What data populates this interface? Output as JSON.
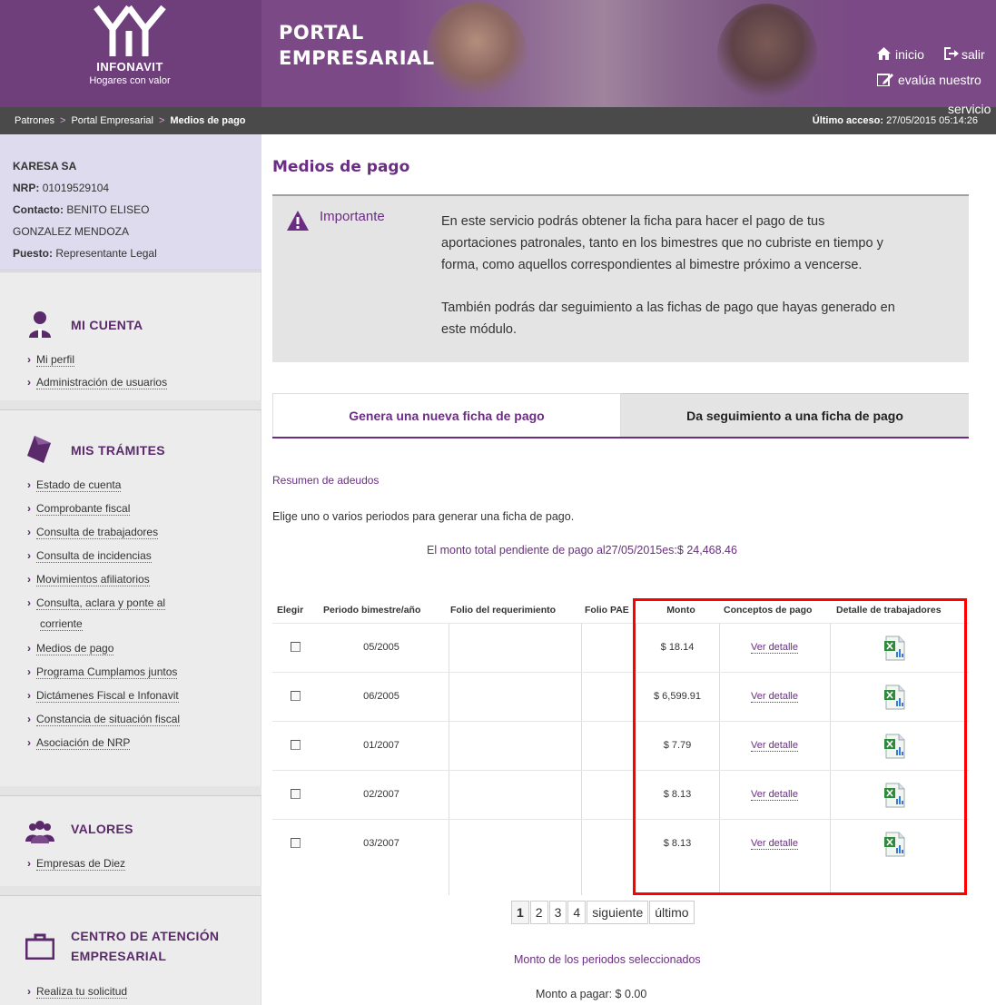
{
  "header": {
    "logo_text": "INFONAVIT",
    "logo_sub": "Hogares con valor",
    "portal_line1": "PORTAL",
    "portal_line2": "EMPRESARIAL",
    "inicio": "inicio",
    "salir": "salir",
    "evalua": "evalúa nuestro",
    "servicio": "servicio"
  },
  "breadcrumb": {
    "items": [
      "Patrones",
      "Portal Empresarial",
      "Medios de pago"
    ],
    "separator": ">",
    "access_label": "Último acceso:",
    "access_value": "27/05/2015 05:14:26"
  },
  "profile": {
    "company": "KARESA SA",
    "nrp_label": "NRP:",
    "nrp_value": "01019529104",
    "contact_label": "Contacto:",
    "contact_value_1": "BENITO ELISEO",
    "contact_value_2": "GONZALEZ MENDOZA",
    "puesto_label": "Puesto:",
    "puesto_value": "Representante Legal"
  },
  "sidebar": {
    "mi_cuenta": {
      "title": "MI CUENTA",
      "items": [
        "Mi perfil",
        "Administración de usuarios"
      ]
    },
    "mis_tramites": {
      "title": "MIS TRÁMITES",
      "items": [
        "Estado de cuenta",
        "Comprobante fiscal",
        "Consulta de trabajadores",
        "Consulta de incidencias",
        "Movimientos afiliatorios",
        "Consulta, aclara y ponte al",
        "corriente",
        "Medios de pago",
        "Programa Cumplamos juntos",
        "Dictámenes Fiscal e Infonavit",
        "Constancia de situación fiscal",
        "Asociación de NRP"
      ]
    },
    "valores": {
      "title": "VALORES",
      "items": [
        "Empresas de Diez"
      ]
    },
    "centro": {
      "title_1": "CENTRO DE ATENCIÓN",
      "title_2": "EMPRESARIAL",
      "items": [
        "Realiza tu solicitud"
      ]
    }
  },
  "main": {
    "title": "Medios de pago",
    "notice": {
      "label": "Importante",
      "p1_l1": "En este servicio podrás obtener la ficha para hacer el pago de tus",
      "p1_l2": "aportaciones patronales, tanto en los bimestres que no cubriste en tiempo y",
      "p1_l3": "forma, como aquellos correspondientes al bimestre próximo a vencerse.",
      "p2_l1": "También podrás dar seguimiento a las fichas de pago que hayas generado en",
      "p2_l2": "este módulo."
    },
    "tabs": [
      "Genera una nueva ficha de pago",
      "Da seguimiento a una ficha de pago"
    ],
    "resumen": "Resumen de adeudos",
    "elige": "Elige uno o varios periodos para generar una ficha de pago.",
    "monto_total": "El monto total pendiente de pago al27/05/2015es:$ 24,468.46",
    "table": {
      "headers": [
        "Elegir",
        "Periodo bimestre/año",
        "Folio del requerimiento",
        "Folio PAE",
        "Monto",
        "Conceptos de pago",
        "Detalle de trabajadores"
      ],
      "rows": [
        {
          "periodo": "05/2005",
          "monto": "$ 18.14",
          "concepto": "Ver detalle"
        },
        {
          "periodo": "06/2005",
          "monto": "$ 6,599.91",
          "concepto": "Ver detalle"
        },
        {
          "periodo": "01/2007",
          "monto": "$ 7.79",
          "concepto": "Ver detalle"
        },
        {
          "periodo": "02/2007",
          "monto": "$ 8.13",
          "concepto": "Ver detalle"
        },
        {
          "periodo": "03/2007",
          "monto": "$ 8.13",
          "concepto": "Ver detalle"
        }
      ]
    },
    "pager": [
      "1",
      "2",
      "3",
      "4",
      "siguiente",
      "último"
    ],
    "monto_seleccionados": "Monto de los periodos seleccionados",
    "monto_pagar": "Monto a pagar: $ 0.00"
  },
  "colors": {
    "brand_purple": "#6b2d83",
    "banner": "#7b4a86",
    "highlight": "#ff0000"
  }
}
